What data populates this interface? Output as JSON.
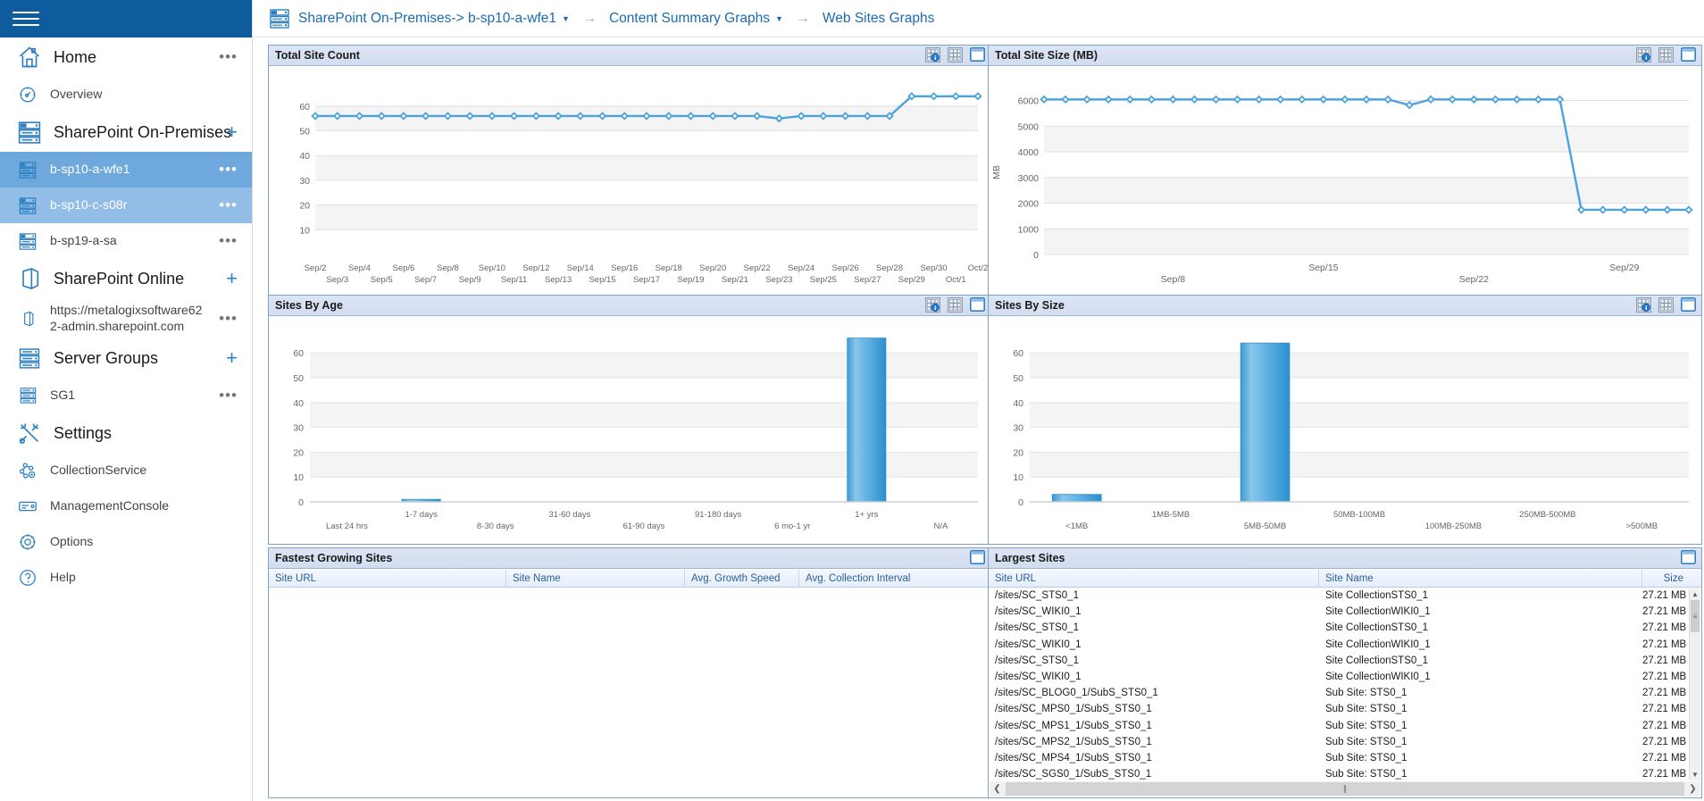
{
  "colors": {
    "header_blue": "#0e5c9e",
    "accent": "#1c6bb0",
    "series_blue": "#4ba3dd",
    "panel_head": "#d7e1f2",
    "selected": "#6ea8dc",
    "selected_alt": "#92bde6"
  },
  "sidebar": {
    "menu_icon": "hamburger-icon",
    "items": [
      {
        "label": "Home",
        "icon": "home-icon",
        "level": 1,
        "trailing": "dots"
      },
      {
        "label": "Overview",
        "icon": "gauge-icon",
        "level": 2,
        "trailing": ""
      },
      {
        "label": "SharePoint On-Premises",
        "icon": "server-icon",
        "level": 1,
        "trailing": "plus"
      },
      {
        "label": "b-sp10-a-wfe1",
        "icon": "server-small-icon",
        "level": 2,
        "trailing": "dots",
        "state": "selected"
      },
      {
        "label": "b-sp10-c-s08r",
        "icon": "server-small-icon",
        "level": 2,
        "trailing": "dots",
        "state": "selected2"
      },
      {
        "label": "b-sp19-a-sa",
        "icon": "server-small-icon",
        "level": 2,
        "trailing": "dots"
      },
      {
        "label": "SharePoint Online",
        "icon": "cloud-door-icon",
        "level": 1,
        "trailing": "plus"
      },
      {
        "label": "https://metalogixsoftware622-admin.sharepoint.com",
        "icon": "door-small-icon",
        "level": 2,
        "trailing": "dots",
        "wrap": true
      },
      {
        "label": "Server Groups",
        "icon": "rack-icon",
        "level": 1,
        "trailing": "plus"
      },
      {
        "label": "SG1",
        "icon": "rack-small-icon",
        "level": 2,
        "trailing": "dots"
      },
      {
        "label": "Settings",
        "icon": "tools-icon",
        "level": 1,
        "trailing": ""
      },
      {
        "label": "CollectionService",
        "icon": "nodes-icon",
        "level": 2,
        "trailing": ""
      },
      {
        "label": "ManagementConsole",
        "icon": "console-icon",
        "level": 2,
        "trailing": ""
      },
      {
        "label": "Options",
        "icon": "gear-icon",
        "level": 2,
        "trailing": ""
      },
      {
        "label": "Help",
        "icon": "help-icon",
        "level": 2,
        "trailing": ""
      }
    ]
  },
  "breadcrumb": {
    "icon": "server-icon",
    "items": [
      {
        "label": "SharePoint On-Premises-> b-sp10-a-wfe1",
        "dropdown": true
      },
      {
        "label": "Content Summary Graphs",
        "dropdown": true
      },
      {
        "label": "Web Sites Graphs",
        "dropdown": false
      }
    ],
    "separator": "→"
  },
  "panels": {
    "total_site_count": {
      "title": "Total Site Count",
      "icons": [
        "chart-info-icon",
        "grid-icon",
        "maximize-icon"
      ]
    },
    "total_site_size": {
      "title": "Total Site Size (MB)",
      "icons": [
        "chart-info-icon",
        "grid-icon",
        "maximize-icon"
      ]
    },
    "sites_by_age": {
      "title": "Sites By Age",
      "icons": [
        "chart-info-icon",
        "grid-icon",
        "maximize-icon"
      ]
    },
    "sites_by_size": {
      "title": "Sites By Size",
      "icons": [
        "chart-info-icon",
        "grid-icon",
        "maximize-icon"
      ]
    },
    "fastest_growing": {
      "title": "Fastest Growing Sites",
      "icons": [
        "maximize-icon"
      ],
      "columns": [
        "Site URL",
        "Site Name",
        "Avg. Growth Speed",
        "Avg. Collection Interval"
      ],
      "rows": []
    },
    "largest_sites": {
      "title": "Largest Sites",
      "icons": [
        "maximize-icon"
      ],
      "columns": [
        "Site URL",
        "Site Name",
        "Size"
      ],
      "rows": [
        [
          "/sites/SC_STS0_1",
          "Site CollectionSTS0_1",
          "27.21 MB"
        ],
        [
          "/sites/SC_WIKI0_1",
          "Site CollectionWIKI0_1",
          "27.21 MB"
        ],
        [
          "/sites/SC_STS0_1",
          "Site CollectionSTS0_1",
          "27.21 MB"
        ],
        [
          "/sites/SC_WIKI0_1",
          "Site CollectionWIKI0_1",
          "27.21 MB"
        ],
        [
          "/sites/SC_STS0_1",
          "Site CollectionSTS0_1",
          "27.21 MB"
        ],
        [
          "/sites/SC_WIKI0_1",
          "Site CollectionWIKI0_1",
          "27.21 MB"
        ],
        [
          "/sites/SC_BLOG0_1/SubS_STS0_1",
          "Sub Site: STS0_1",
          "27.21 MB"
        ],
        [
          "/sites/SC_MPS0_1/SubS_STS0_1",
          "Sub Site: STS0_1",
          "27.21 MB"
        ],
        [
          "/sites/SC_MPS1_1/SubS_STS0_1",
          "Sub Site: STS0_1",
          "27.21 MB"
        ],
        [
          "/sites/SC_MPS2_1/SubS_STS0_1",
          "Sub Site: STS0_1",
          "27.21 MB"
        ],
        [
          "/sites/SC_MPS4_1/SubS_STS0_1",
          "Sub Site: STS0_1",
          "27.21 MB"
        ],
        [
          "/sites/SC_SGS0_1/SubS_STS0_1",
          "Sub Site: STS0_1",
          "27.21 MB"
        ]
      ]
    }
  },
  "chart_data": [
    {
      "id": "total_site_count",
      "type": "line",
      "title": "Total Site Count",
      "xlabel": "",
      "ylabel": "",
      "ylim": [
        0,
        65
      ],
      "yticks": [
        10,
        20,
        30,
        40,
        50,
        60
      ],
      "grid": true,
      "x": [
        "Sep/2",
        "Sep/3",
        "Sep/4",
        "Sep/5",
        "Sep/6",
        "Sep/7",
        "Sep/8",
        "Sep/9",
        "Sep/10",
        "Sep/11",
        "Sep/12",
        "Sep/13",
        "Sep/14",
        "Sep/15",
        "Sep/16",
        "Sep/17",
        "Sep/18",
        "Sep/19",
        "Sep/20",
        "Sep/21",
        "Sep/22",
        "Sep/23",
        "Sep/24",
        "Sep/25",
        "Sep/26",
        "Sep/27",
        "Sep/28",
        "Sep/29",
        "Sep/30",
        "Oct/1",
        "Oct/2"
      ],
      "values": [
        56,
        56,
        56,
        56,
        56,
        56,
        56,
        56,
        56,
        56,
        56,
        56,
        56,
        56,
        56,
        56,
        56,
        56,
        56,
        56,
        56,
        55,
        56,
        56,
        56,
        56,
        56,
        64,
        64,
        64,
        64
      ],
      "series": [
        {
          "name": "Total Site Count",
          "color": "#4ba3dd"
        }
      ]
    },
    {
      "id": "total_site_size",
      "type": "line",
      "title": "Total Site Size (MB)",
      "xlabel": "",
      "ylabel": "MB",
      "ylim": [
        0,
        6400
      ],
      "yticks": [
        0,
        1000,
        2000,
        3000,
        4000,
        5000,
        6000
      ],
      "grid": true,
      "xticks": [
        "Sep/8",
        "Sep/15",
        "Sep/22",
        "Sep/29"
      ],
      "x": [
        "Sep/2",
        "Sep/3",
        "Sep/4",
        "Sep/5",
        "Sep/6",
        "Sep/7",
        "Sep/8",
        "Sep/9",
        "Sep/10",
        "Sep/11",
        "Sep/12",
        "Sep/13",
        "Sep/14",
        "Sep/15",
        "Sep/16",
        "Sep/17",
        "Sep/18",
        "Sep/19",
        "Sep/20",
        "Sep/21",
        "Sep/22",
        "Sep/23",
        "Sep/24",
        "Sep/25",
        "Sep/26",
        "Sep/27",
        "Sep/28",
        "Sep/29",
        "Sep/30",
        "Oct/1",
        "Oct/2"
      ],
      "values": [
        6040,
        6040,
        6040,
        6040,
        6040,
        6040,
        6040,
        6040,
        6040,
        6040,
        6040,
        6040,
        6040,
        6040,
        6040,
        6040,
        6040,
        5820,
        6040,
        6040,
        6040,
        6040,
        6040,
        6040,
        6040,
        1740,
        1740,
        1740,
        1740,
        1740,
        1740
      ],
      "series": [
        {
          "name": "Total Site Size",
          "color": "#4ba3dd"
        }
      ]
    },
    {
      "id": "sites_by_age",
      "type": "bar",
      "title": "Sites By Age",
      "xlabel": "",
      "ylabel": "",
      "ylim": [
        0,
        68
      ],
      "yticks": [
        0,
        10,
        20,
        30,
        40,
        50,
        60
      ],
      "grid": true,
      "categories": [
        "Last 24 hrs",
        "1-7 days",
        "8-30 days",
        "31-60 days",
        "61-90 days",
        "91-180 days",
        "6 mo-1 yr",
        "1+ yrs",
        "N/A"
      ],
      "values": [
        0,
        1,
        0,
        0,
        0,
        0,
        0,
        66,
        0
      ],
      "series": [
        {
          "name": "Sites By Age",
          "color": "#5fb0e0"
        }
      ]
    },
    {
      "id": "sites_by_size",
      "type": "bar",
      "title": "Sites By Size",
      "xlabel": "",
      "ylabel": "",
      "ylim": [
        0,
        68
      ],
      "yticks": [
        0,
        10,
        20,
        30,
        40,
        50,
        60
      ],
      "grid": true,
      "categories": [
        "<1MB",
        "1MB-5MB",
        "5MB-50MB",
        "50MB-100MB",
        "100MB-250MB",
        "250MB-500MB",
        ">500MB"
      ],
      "values": [
        3,
        0,
        64,
        0,
        0,
        0,
        0
      ],
      "series": [
        {
          "name": "Sites By Size",
          "color": "#5fb0e0"
        }
      ]
    }
  ]
}
